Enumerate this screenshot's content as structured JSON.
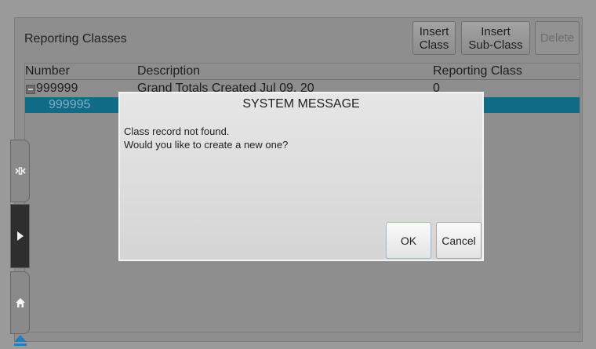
{
  "panel": {
    "title": "Reporting Classes",
    "toolbar": {
      "insert_class": [
        "Insert",
        "Class"
      ],
      "insert_subclass": [
        "Insert",
        "Sub-Class"
      ],
      "delete": "Delete"
    }
  },
  "grid": {
    "columns": [
      "Number",
      "Description",
      "Reporting Class"
    ],
    "rows": [
      {
        "number": "999999",
        "description": "Grand Totals Created Jul 09, 20",
        "reporting_class": "0"
      },
      {
        "number": "999995",
        "description": "",
        "reporting_class": ""
      }
    ]
  },
  "dialog": {
    "title": "SYSTEM MESSAGE",
    "message_lines": [
      "Class record not found.",
      "Would you like to create a new one?"
    ],
    "ok": "OK",
    "cancel": "Cancel"
  },
  "sidebar": {
    "icons": [
      "collapse-toggle-icon",
      "play-icon",
      "home-icon",
      "eject-icon"
    ]
  },
  "colors": {
    "selected_row": "#0f6b86",
    "accent": "#1e7fc0"
  }
}
